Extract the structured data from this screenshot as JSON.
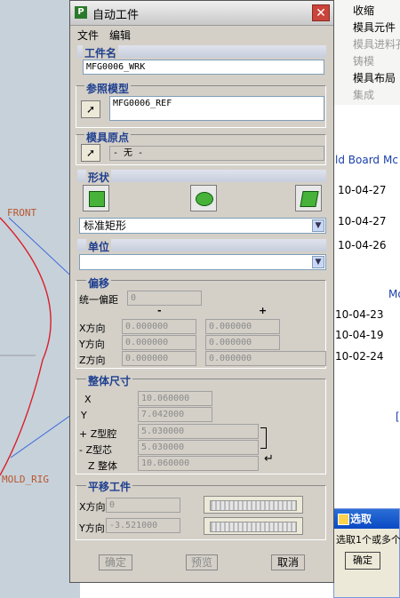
{
  "dialog": {
    "title": "自动工件",
    "menu": [
      "文件",
      "编辑"
    ],
    "workpiece_name": {
      "label": "工件名",
      "value": "MFG0006_WRK"
    },
    "reference_model": {
      "label": "参照模型",
      "value": "MFG0006_REF"
    },
    "mold_origin": {
      "label": "模具原点",
      "value": "- 无 -"
    },
    "shape": {
      "label": "形状",
      "selected": "标准矩形"
    },
    "unit": {
      "label": "单位",
      "selected": ""
    },
    "offset": {
      "label": "偏移",
      "uniform_label": "统一偏距",
      "uniform_value": "0",
      "minus": "-",
      "plus": "+",
      "rows": [
        {
          "label": "X方向",
          "minus": "0.000000",
          "plus": "0.000000"
        },
        {
          "label": "Y方向",
          "minus": "0.000000",
          "plus": "0.000000"
        },
        {
          "label": "Z方向",
          "minus": "0.000000",
          "plus": "0.000000"
        }
      ]
    },
    "overall_size": {
      "label": "整体尺寸",
      "rows": [
        {
          "label": "X",
          "value": "10.060000"
        },
        {
          "label": "Y",
          "value": "7.042000"
        },
        {
          "label": "+ Z型腔",
          "value": "5.030000"
        },
        {
          "label": "- Z型芯",
          "value": "5.030000"
        },
        {
          "label": "Z 整体",
          "value": "10.060000"
        }
      ]
    },
    "translate": {
      "label": "平移工件",
      "rows": [
        {
          "label": "X方向",
          "value": "0"
        },
        {
          "label": "Y方向",
          "value": "-3.521000"
        }
      ]
    },
    "buttons": {
      "ok": "确定",
      "preview": "预览",
      "cancel": "取消"
    }
  },
  "background_menu": {
    "items": [
      {
        "label": "收缩",
        "enabled": true
      },
      {
        "label": "模具元件",
        "enabled": true
      },
      {
        "label": "模具进料孔",
        "enabled": false
      },
      {
        "label": "铸模",
        "enabled": false
      },
      {
        "label": "模具布局",
        "enabled": true
      },
      {
        "label": "集成",
        "enabled": false
      }
    ]
  },
  "background_list": {
    "header_links": [
      "ld Board",
      "Mc"
    ],
    "dates": [
      "10-04-27",
      "10-04-27",
      "10-04-26",
      "10-04-23",
      "10-04-19",
      "10-02-24"
    ],
    "more_link": "Mo",
    "tail_link": "["
  },
  "viewport": {
    "front_label": "FRONT",
    "mold_label": "MOLD_RIG"
  },
  "select_dialog": {
    "title": "选取",
    "message": "选取1个或多个",
    "ok": "确定"
  }
}
